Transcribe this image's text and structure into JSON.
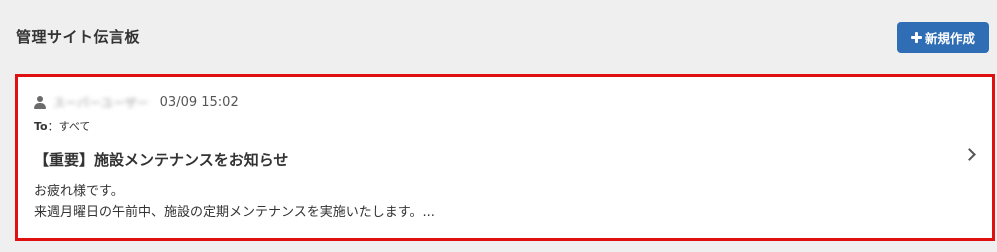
{
  "header": {
    "title": "管理サイト伝言板",
    "new_button_label": "新規作成"
  },
  "post": {
    "author": "スーパーユーザー",
    "datetime": "03/09 15:02",
    "to_label": "To",
    "to_separator": "：",
    "to_value": "すべて",
    "title": "【重要】施設メンテナンスをお知らせ",
    "body_lines": [
      "お疲れ様です。",
      "来週月曜日の午前中、施設の定期メンテナンスを実施いたします。..."
    ]
  },
  "colors": {
    "background": "#efefef",
    "primary_button": "#2f6db5",
    "highlight_border": "#e01010",
    "card_background": "#ffffff"
  },
  "icons": {
    "new_button": "plus-icon",
    "author": "user-icon",
    "open_post": "chevron-right-icon"
  }
}
